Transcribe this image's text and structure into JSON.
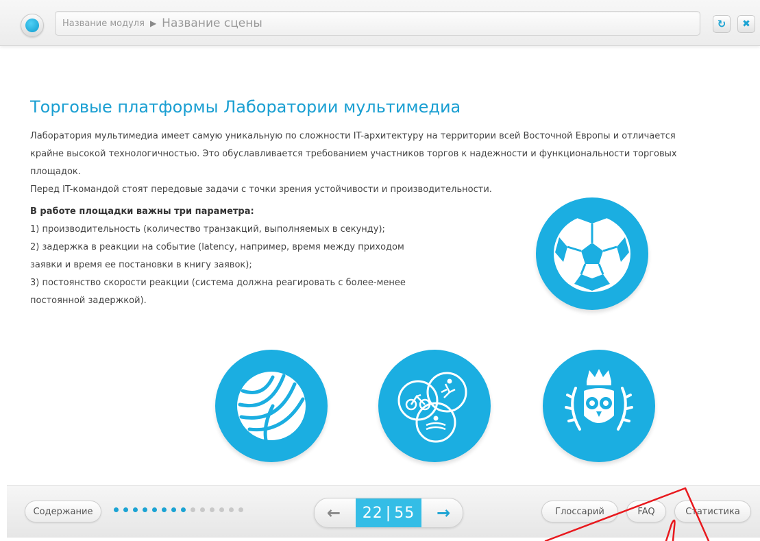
{
  "header": {
    "module_name": "Название модуля",
    "separator": "▶",
    "scene_name": "Название сцены",
    "refresh_icon": "refresh-icon",
    "close_icon": "close-icon"
  },
  "content": {
    "title": "Торговые платформы Лаборатории мультимедиа",
    "intro_lines": [
      "Лаборатория мультимедиа имеет самую уникальную по сложности IT-архитектуру на территории всей Восточной Европы и отличается",
      "крайне высокой технологичностью. Это обуславливается требованием участников торгов к надежности и функциональности торговых",
      "площадок.",
      "Перед IT-командой стоят передовые задачи с точки зрения устойчивости и производительности."
    ],
    "params_heading": "В работе площадки важны три параметра:",
    "params_lines": [
      "1) производительность (количество транзакций, выполняемых в секунду);",
      "2) задержка в реакции на событие (latency, например, время между приходом",
      "заявки и время ее постановки в книгу заявок);",
      "3) постоянство скорости реакции (система должна реагировать с более-менее",
      "постоянной задержкой)."
    ],
    "icons": [
      "soccer-ball-icon",
      "volleyball-icon",
      "triathlon-icon",
      "owl-crown-icon"
    ],
    "accent_color": "#1baee1"
  },
  "footer": {
    "contents_label": "Содержание",
    "progress_dots_total": 14,
    "progress_dots_filled": 8,
    "page_current": "22",
    "page_sep": "|",
    "page_total": "55",
    "glossary_label": "Глоссарий",
    "faq_label": "FAQ",
    "stats_label": "Статистика",
    "prev_icon": "arrow-left-icon",
    "next_icon": "arrow-right-icon"
  }
}
